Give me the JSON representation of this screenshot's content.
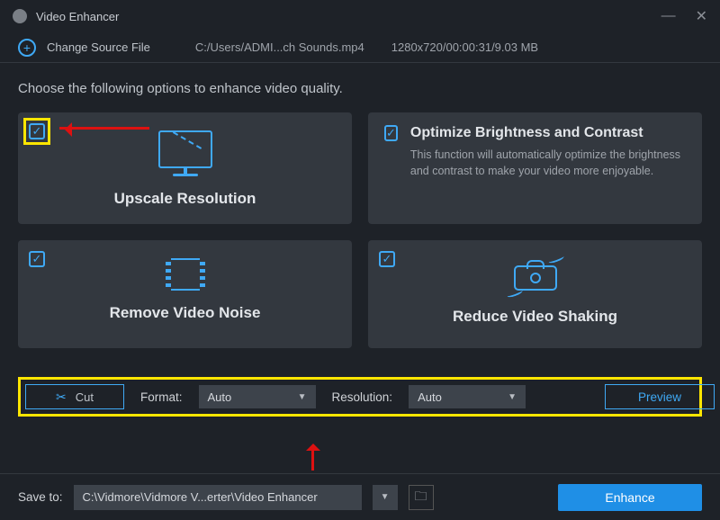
{
  "app_title": "Video Enhancer",
  "change_source_label": "Change Source File",
  "source_path": "C:/Users/ADMI...ch Sounds.mp4",
  "source_info": "1280x720/00:00:31/9.03 MB",
  "instruction": "Choose the following options to enhance video quality.",
  "cards": {
    "upscale": {
      "title": "Upscale Resolution"
    },
    "brightness": {
      "title": "Optimize Brightness and Contrast",
      "description": "This function will automatically optimize the brightness and contrast to make your video more enjoyable."
    },
    "noise": {
      "title": "Remove Video Noise"
    },
    "shaking": {
      "title": "Reduce Video Shaking"
    }
  },
  "toolbar": {
    "cut_label": "Cut",
    "format_label": "Format:",
    "format_value": "Auto",
    "resolution_label": "Resolution:",
    "resolution_value": "Auto",
    "preview_label": "Preview"
  },
  "save": {
    "label": "Save to:",
    "path": "C:\\Vidmore\\Vidmore V...erter\\Video Enhancer"
  },
  "enhance_label": "Enhance"
}
